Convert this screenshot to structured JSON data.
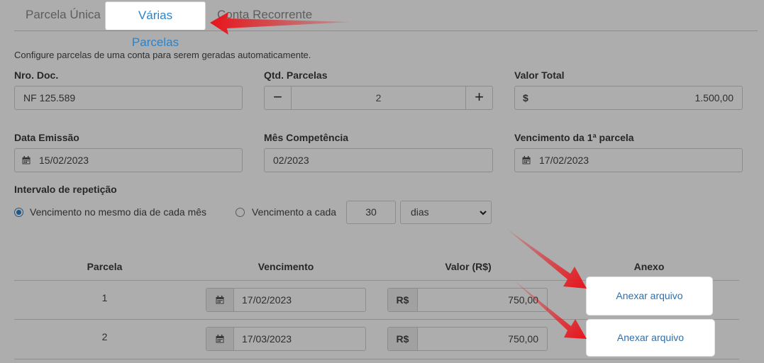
{
  "tabs": [
    {
      "label": "Parcela Única",
      "active": false
    },
    {
      "label": "Várias Parcelas",
      "active": true
    },
    {
      "label": "Conta Recorrente",
      "active": false
    }
  ],
  "hint": "Configure parcelas de uma conta para serem geradas automaticamente.",
  "form": {
    "nro_doc": {
      "label": "Nro. Doc.",
      "value": "NF 125.589"
    },
    "qtd_parcelas": {
      "label": "Qtd. Parcelas",
      "value": "2",
      "minus": "−",
      "plus": "+"
    },
    "valor_total": {
      "label": "Valor Total",
      "currency": "$",
      "value": "1.500,00"
    },
    "data_emissao": {
      "label": "Data Emissão",
      "value": "15/02/2023"
    },
    "mes_competencia": {
      "label": "Mês Competência",
      "value": "02/2023"
    },
    "vencimento_1": {
      "label": "Vencimento da 1ª parcela",
      "value": "17/02/2023"
    }
  },
  "intervalo": {
    "label": "Intervalo de repetição",
    "option_same_day": {
      "label": "Vencimento no mesmo dia de cada mês",
      "selected": true
    },
    "option_every": {
      "label": "Vencimento a cada",
      "selected": false
    },
    "every_value": "30",
    "unit": "dias"
  },
  "table": {
    "headers": [
      "Parcela",
      "Vencimento",
      "Valor (R$)",
      "Anexo"
    ],
    "currency": "R$",
    "rows": [
      {
        "parcela": "1",
        "vencimento": "17/02/2023",
        "valor": "750,00",
        "anexo": "Anexar arquivo"
      },
      {
        "parcela": "2",
        "vencimento": "17/03/2023",
        "valor": "750,00",
        "anexo": "Anexar arquivo"
      }
    ]
  },
  "colors": {
    "accent": "#2c83c9",
    "link": "#2c6fb0",
    "arrow": "#e8141b"
  },
  "icons": {
    "calendar": "calendar-icon",
    "chevron": "chevron-down-icon",
    "arrow": "annotation-arrow"
  }
}
